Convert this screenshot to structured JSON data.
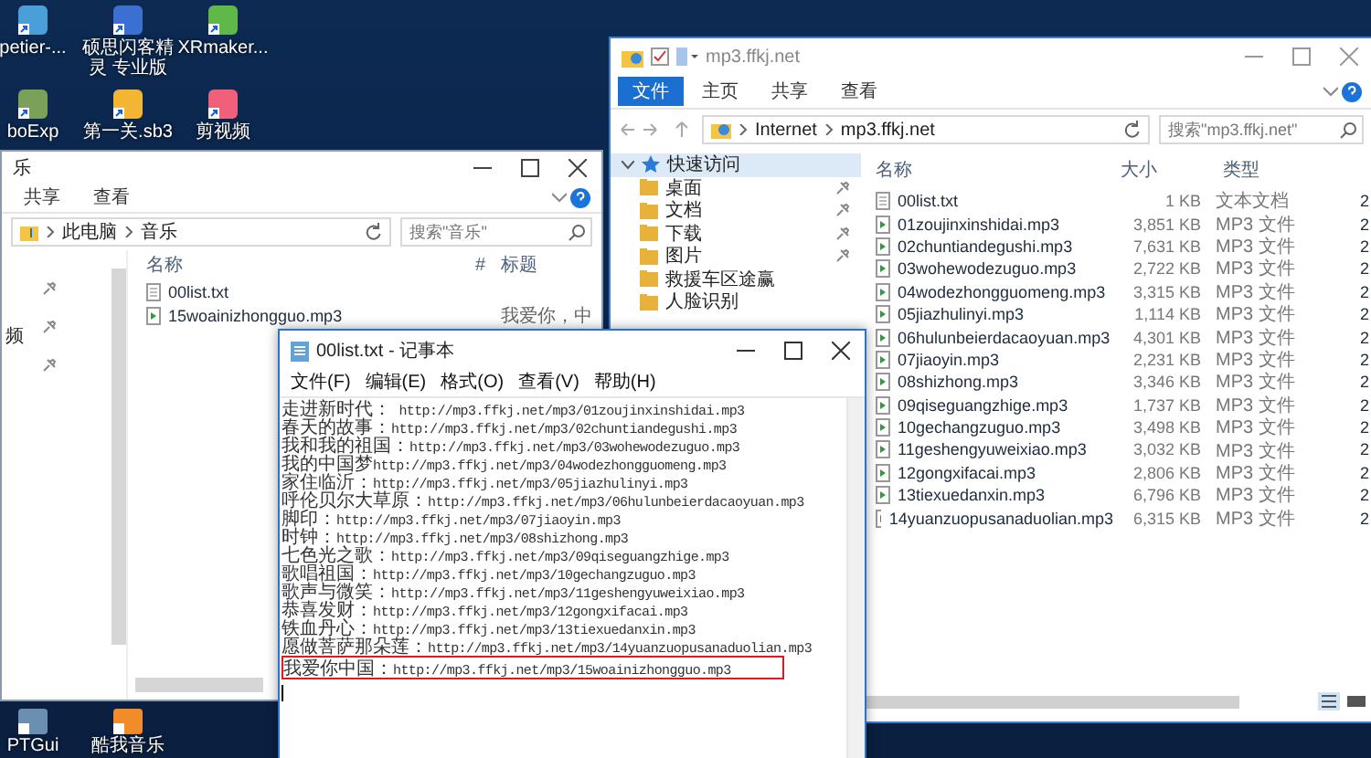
{
  "desktop_icons_top": [
    {
      "label": "petier-...",
      "color": "#4a9fd8"
    },
    {
      "label": "硕思闪客精灵 专业版",
      "color": "#3b6fd1"
    },
    {
      "label": "XRmaker...",
      "color": "#5fb848"
    },
    {
      "label": "boExp",
      "color": "#7aa05a"
    },
    {
      "label": "第一关.sb3",
      "color": "#f2b632"
    },
    {
      "label": "剪视频",
      "color": "#f0607a"
    }
  ],
  "desktop_icons_bottom": [
    {
      "label": "PTGui",
      "color": "#6a8fb0"
    },
    {
      "label": "酷我音乐",
      "color": "#f28c28"
    }
  ],
  "music_window": {
    "title": "乐",
    "tabs": [
      {
        "label": "共享",
        "selected": false
      },
      {
        "label": "查看",
        "selected": false
      }
    ],
    "breadcrumb": [
      "此电脑",
      "音乐"
    ],
    "search": {
      "placeholder": "搜索\"音乐\""
    },
    "nav_items": [
      "频"
    ],
    "columns": [
      "名称",
      "#",
      "标题"
    ],
    "files": [
      {
        "kind": "txt",
        "name": "00list.txt"
      },
      {
        "kind": "mp3",
        "name": "15woainizhongguo.mp3",
        "title": "我爱你，中"
      }
    ]
  },
  "web_window": {
    "title": "mp3.ffkj.net",
    "tabs": [
      {
        "label": "文件",
        "selected": true
      },
      {
        "label": "主页",
        "selected": false
      },
      {
        "label": "共享",
        "selected": false
      },
      {
        "label": "查看",
        "selected": false
      }
    ],
    "breadcrumb": [
      "Internet",
      "mp3.ffkj.net"
    ],
    "search": {
      "placeholder": "搜索\"mp3.ffkj.net\""
    },
    "nav_items": [
      {
        "label": "快速访问",
        "kind": "group",
        "pinned": false,
        "selected": true
      },
      {
        "label": "桌面",
        "kind": "folder",
        "pinned": true,
        "selected": false
      },
      {
        "label": "文档",
        "kind": "folder",
        "pinned": true,
        "selected": false
      },
      {
        "label": "下载",
        "kind": "folder",
        "pinned": true,
        "selected": false
      },
      {
        "label": "图片",
        "kind": "folder",
        "pinned": true,
        "selected": false
      },
      {
        "label": "救援车区途赢",
        "kind": "folder",
        "pinned": false,
        "selected": false
      },
      {
        "label": "人脸识别",
        "kind": "folder",
        "pinned": false,
        "selected": false
      }
    ],
    "columns": [
      "名称",
      "大小",
      "类型"
    ],
    "files": [
      {
        "kind": "txt",
        "name": "00list.txt",
        "size": "1 KB",
        "type": "文本文档",
        "column_4": "2"
      },
      {
        "kind": "mp3",
        "name": "01zoujinxinshidai.mp3",
        "size": "3,851 KB",
        "type": "MP3 文件",
        "column_4": "2"
      },
      {
        "kind": "mp3",
        "name": "02chuntiandegushi.mp3",
        "size": "7,631 KB",
        "type": "MP3 文件",
        "column_4": "2"
      },
      {
        "kind": "mp3",
        "name": "03wohewodezuguo.mp3",
        "size": "2,722 KB",
        "type": "MP3 文件",
        "column_4": "2"
      },
      {
        "kind": "mp3",
        "name": "04wodezhongguomeng.mp3",
        "size": "3,315 KB",
        "type": "MP3 文件",
        "column_4": "2"
      },
      {
        "kind": "mp3",
        "name": "05jiazhulinyi.mp3",
        "size": "1,114 KB",
        "type": "MP3 文件",
        "column_4": "2"
      },
      {
        "kind": "mp3",
        "name": "06hulunbeierdacaoyuan.mp3",
        "size": "4,301 KB",
        "type": "MP3 文件",
        "column_4": "2"
      },
      {
        "kind": "mp3",
        "name": "07jiaoyin.mp3",
        "size": "2,231 KB",
        "type": "MP3 文件",
        "column_4": "2"
      },
      {
        "kind": "mp3",
        "name": "08shizhong.mp3",
        "size": "3,346 KB",
        "type": "MP3 文件",
        "column_4": "2"
      },
      {
        "kind": "mp3",
        "name": "09qiseguangzhige.mp3",
        "size": "1,737 KB",
        "type": "MP3 文件",
        "column_4": "2"
      },
      {
        "kind": "mp3",
        "name": "10gechangzuguo.mp3",
        "size": "3,498 KB",
        "type": "MP3 文件",
        "column_4": "2"
      },
      {
        "kind": "mp3",
        "name": "11geshengyuweixiao.mp3",
        "size": "3,032 KB",
        "type": "MP3 文件",
        "column_4": "2"
      },
      {
        "kind": "mp3",
        "name": "12gongxifacai.mp3",
        "size": "2,806 KB",
        "type": "MP3 文件",
        "column_4": "2"
      },
      {
        "kind": "mp3",
        "name": "13tiexuedanxin.mp3",
        "size": "6,796 KB",
        "type": "MP3 文件",
        "column_4": "2"
      },
      {
        "kind": "mp3",
        "name": "14yuanzuopusanaduolian.mp3",
        "size": "6,315 KB",
        "type": "MP3 文件",
        "column_4": "2"
      }
    ]
  },
  "notepad": {
    "title": "00list.txt - 记事本",
    "menu": [
      "文件(F)",
      "编辑(E)",
      "格式(O)",
      "查看(V)",
      "帮助(H)"
    ],
    "lines": [
      {
        "text": "走进新时代： http://mp3.ffkj.net/mp3/01zoujinxinshidai.mp3",
        "highlighted": false
      },
      {
        "text": "春天的故事：http://mp3.ffkj.net/mp3/02chuntiandegushi.mp3",
        "highlighted": false
      },
      {
        "text": "我和我的祖国：http://mp3.ffkj.net/mp3/03wohewodezuguo.mp3",
        "highlighted": false
      },
      {
        "text": "我的中国梦http://mp3.ffkj.net/mp3/04wodezhongguomeng.mp3",
        "highlighted": false
      },
      {
        "text": "家住临沂：http://mp3.ffkj.net/mp3/05jiazhulinyi.mp3",
        "highlighted": false
      },
      {
        "text": "呼伦贝尔大草原：http://mp3.ffkj.net/mp3/06hulunbeierdacaoyuan.mp3",
        "highlighted": false
      },
      {
        "text": "脚印：http://mp3.ffkj.net/mp3/07jiaoyin.mp3",
        "highlighted": false
      },
      {
        "text": "时钟：http://mp3.ffkj.net/mp3/08shizhong.mp3",
        "highlighted": false
      },
      {
        "text": "七色光之歌：http://mp3.ffkj.net/mp3/09qiseguangzhige.mp3",
        "highlighted": false
      },
      {
        "text": "歌唱祖国：http://mp3.ffkj.net/mp3/10gechangzuguo.mp3",
        "highlighted": false
      },
      {
        "text": "歌声与微笑：http://mp3.ffkj.net/mp3/11geshengyuweixiao.mp3",
        "highlighted": false
      },
      {
        "text": "恭喜发财：http://mp3.ffkj.net/mp3/12gongxifacai.mp3",
        "highlighted": false
      },
      {
        "text": "铁血丹心：http://mp3.ffkj.net/mp3/13tiexuedanxin.mp3",
        "highlighted": false
      },
      {
        "text": "愿做菩萨那朵莲：http://mp3.ffkj.net/mp3/14yuanzuopusanaduolian.mp3",
        "highlighted": false
      },
      {
        "text": "我爱你中国：http://mp3.ffkj.net/mp3/15woainizhongguo.mp3",
        "highlighted": true
      }
    ]
  }
}
